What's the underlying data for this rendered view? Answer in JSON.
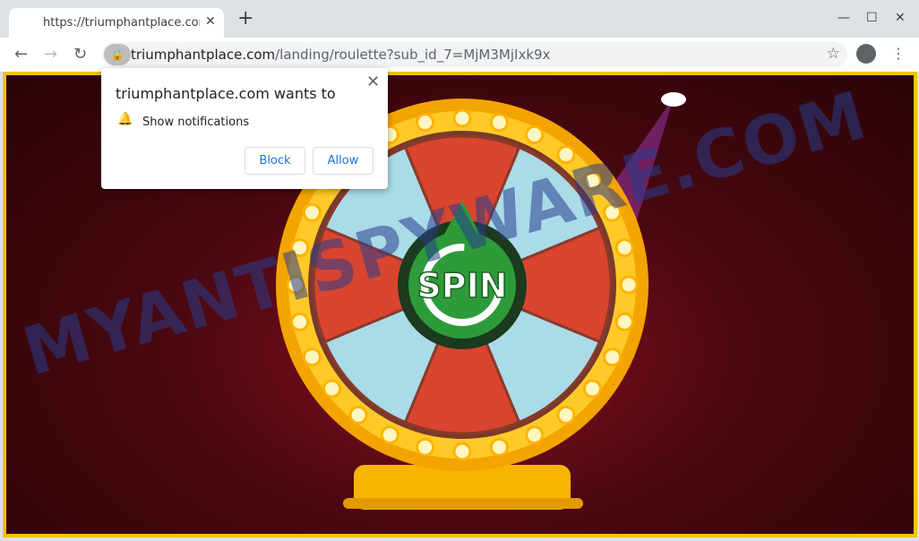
{
  "browser": {
    "tab_title": "https://triumphantplace.com",
    "url_host": "triumphantplace.com",
    "url_path": "/landing/roulette?sub_id_7=MjM3MjIxk9x"
  },
  "page": {
    "watermark": "MYANTISPYWARE.COM",
    "spin_label": "SPIN",
    "colors": {
      "border": "#f4c20d",
      "segment_red": "#d9452e",
      "segment_blue": "#a9dbe8",
      "hub": "#2e9b3a"
    }
  },
  "popup": {
    "title": "triumphantplace.com wants to",
    "permission": "Show notifications",
    "block": "Block",
    "allow": "Allow"
  }
}
